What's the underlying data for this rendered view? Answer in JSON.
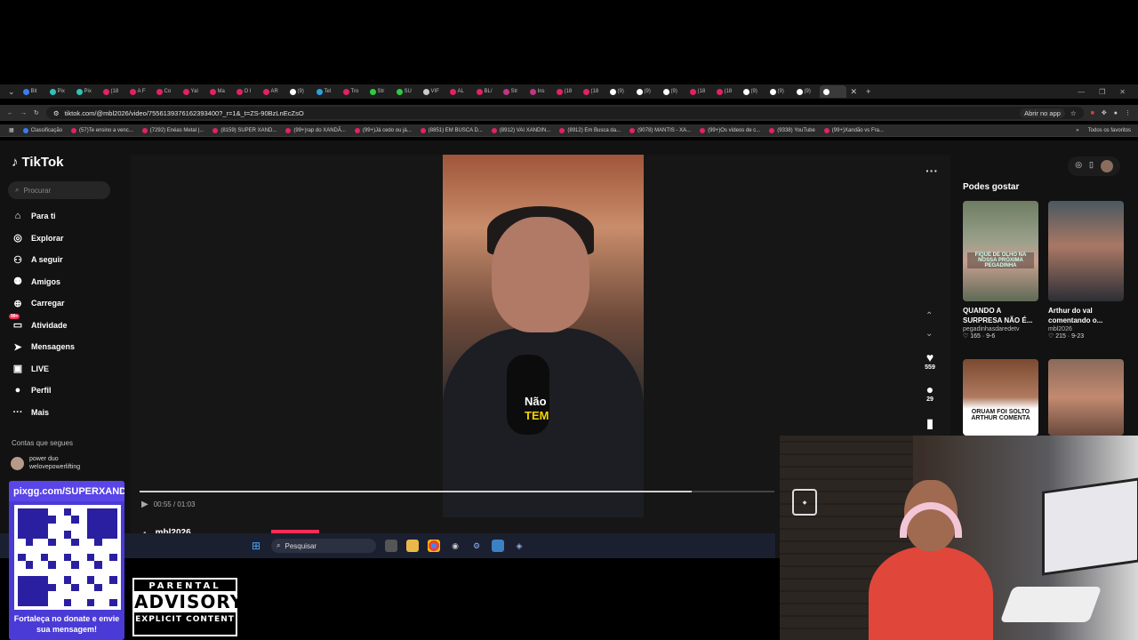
{
  "browser": {
    "tabs": [
      "Bit",
      "Pix",
      "Pix",
      "(18",
      "A F",
      "Co",
      "Yal",
      "Ma",
      "O l",
      "AR",
      "(9)",
      "Tel",
      "Tro",
      "Str",
      "SU",
      "VIF",
      "AL",
      "BL/",
      "Str",
      "Ins",
      "(18",
      "(18",
      "(9)",
      "(9)",
      "(9)",
      "(18",
      "(18",
      "(9)",
      "(9)",
      "(9)",
      ""
    ],
    "url": "tiktok.com/@mbl2026/video/7556139376162393400?_r=1&_t=ZS-90BzLnEcZsO",
    "open_in_app": "Abrir no app",
    "bookmarks": [
      "Classificação",
      "(57)Te ensino a venc...",
      "(7292) Enéas Metal |...",
      "(8159) SUPER XAND...",
      "(99+)rap do XANDÃ...",
      "(99+)Já cedo ou já...",
      "(8851) EM BUSCA D...",
      "(8912) VAI XANDIN...",
      "(8912) Em Busca da...",
      "(9078) MANTIS - XA...",
      "(99+)Os vídeos de c...",
      "(9338) YouTube",
      "(99+)Xandão vs Fra..."
    ],
    "all_favorites": "Todos os favoritos"
  },
  "tiktok": {
    "logo": "TikTok",
    "search_placeholder": "Procurar",
    "nav": [
      {
        "label": "Para ti",
        "icon": "home-icon"
      },
      {
        "label": "Explorar",
        "icon": "compass-icon"
      },
      {
        "label": "A seguir",
        "icon": "following-icon"
      },
      {
        "label": "Amigos",
        "icon": "friends-icon"
      },
      {
        "label": "Carregar",
        "icon": "upload-icon"
      },
      {
        "label": "Atividade",
        "icon": "inbox-icon",
        "badge": "99+"
      },
      {
        "label": "Mensagens",
        "icon": "messages-icon"
      },
      {
        "label": "LIVE",
        "icon": "live-icon"
      },
      {
        "label": "Perfil",
        "icon": "profile-icon"
      },
      {
        "label": "Mais",
        "icon": "more-icon"
      }
    ],
    "follows_title": "Contas que segues",
    "follow_account": {
      "name": "power duo",
      "handle": "welovepowerlifting"
    },
    "video": {
      "caption_line1": "Não",
      "caption_line2": "TEM",
      "likes": "559",
      "comments": "29",
      "time": "00:55 / 01:03",
      "progress": 0.87,
      "author": "mbl2026"
    },
    "recommendations_title": "Podes gostar",
    "recommendations": [
      {
        "title": "QUANDO A SURPRESA NÃO É...",
        "user": "pegadinhasdaredetv",
        "likes": "165",
        "date": "9-6",
        "overlay": "FIQUE DE OLHO NA NOSSA PRÓXIMA PEGADINHA"
      },
      {
        "title": "Arthur do val comentando o...",
        "user": "mbl2026",
        "likes": "215",
        "date": "9-23",
        "overlay": ""
      },
      {
        "overlay": "ORUAM FOI SOLTO ARTHUR COMENTA"
      },
      {
        "overlay": ""
      }
    ]
  },
  "taskbar": {
    "search": "Pesquisar"
  },
  "overlays": {
    "qr_url": "pixgg.com/SUPERXANDAO",
    "qr_footer": "Fortaleça no donate e envie sua mensagem!",
    "advisory_top": "PARENTAL",
    "advisory_mid": "ADVISORY",
    "advisory_bottom": "EXPLICIT CONTENT"
  }
}
